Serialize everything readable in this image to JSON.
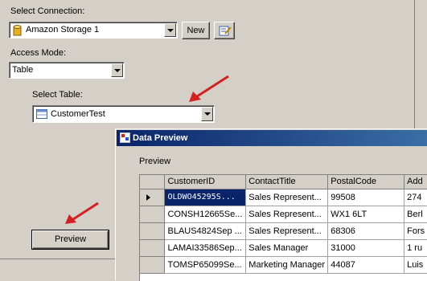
{
  "connection": {
    "label": "Select Connection:",
    "value": "Amazon Storage 1",
    "new_button": "New"
  },
  "access_mode": {
    "label": "Access Mode:",
    "value": "Table"
  },
  "table_select": {
    "label": "Select Table:",
    "value": "CustomerTest"
  },
  "preview_button": "Preview",
  "data_preview": {
    "title": "Data Preview",
    "section_label": "Preview",
    "columns": [
      "CustomerID",
      "ContactTitle",
      "PostalCode",
      "Add"
    ],
    "rows": [
      [
        "OLDWO45295S...",
        "Sales Represent...",
        "99508",
        "274"
      ],
      [
        "CONSH12665Se...",
        "Sales Represent...",
        "WX1 6LT",
        "Berl"
      ],
      [
        "BLAUS4824Sep ...",
        "Sales Represent...",
        "68306",
        "Fors"
      ],
      [
        "LAMAI33586Sep...",
        "Sales Manager",
        "31000",
        "1 ru"
      ],
      [
        "TOMSP65099Se...",
        "Marketing Manager",
        "44087",
        "Luis"
      ]
    ]
  },
  "accent_color": "#0a246a",
  "arrow_color": "#d42020"
}
